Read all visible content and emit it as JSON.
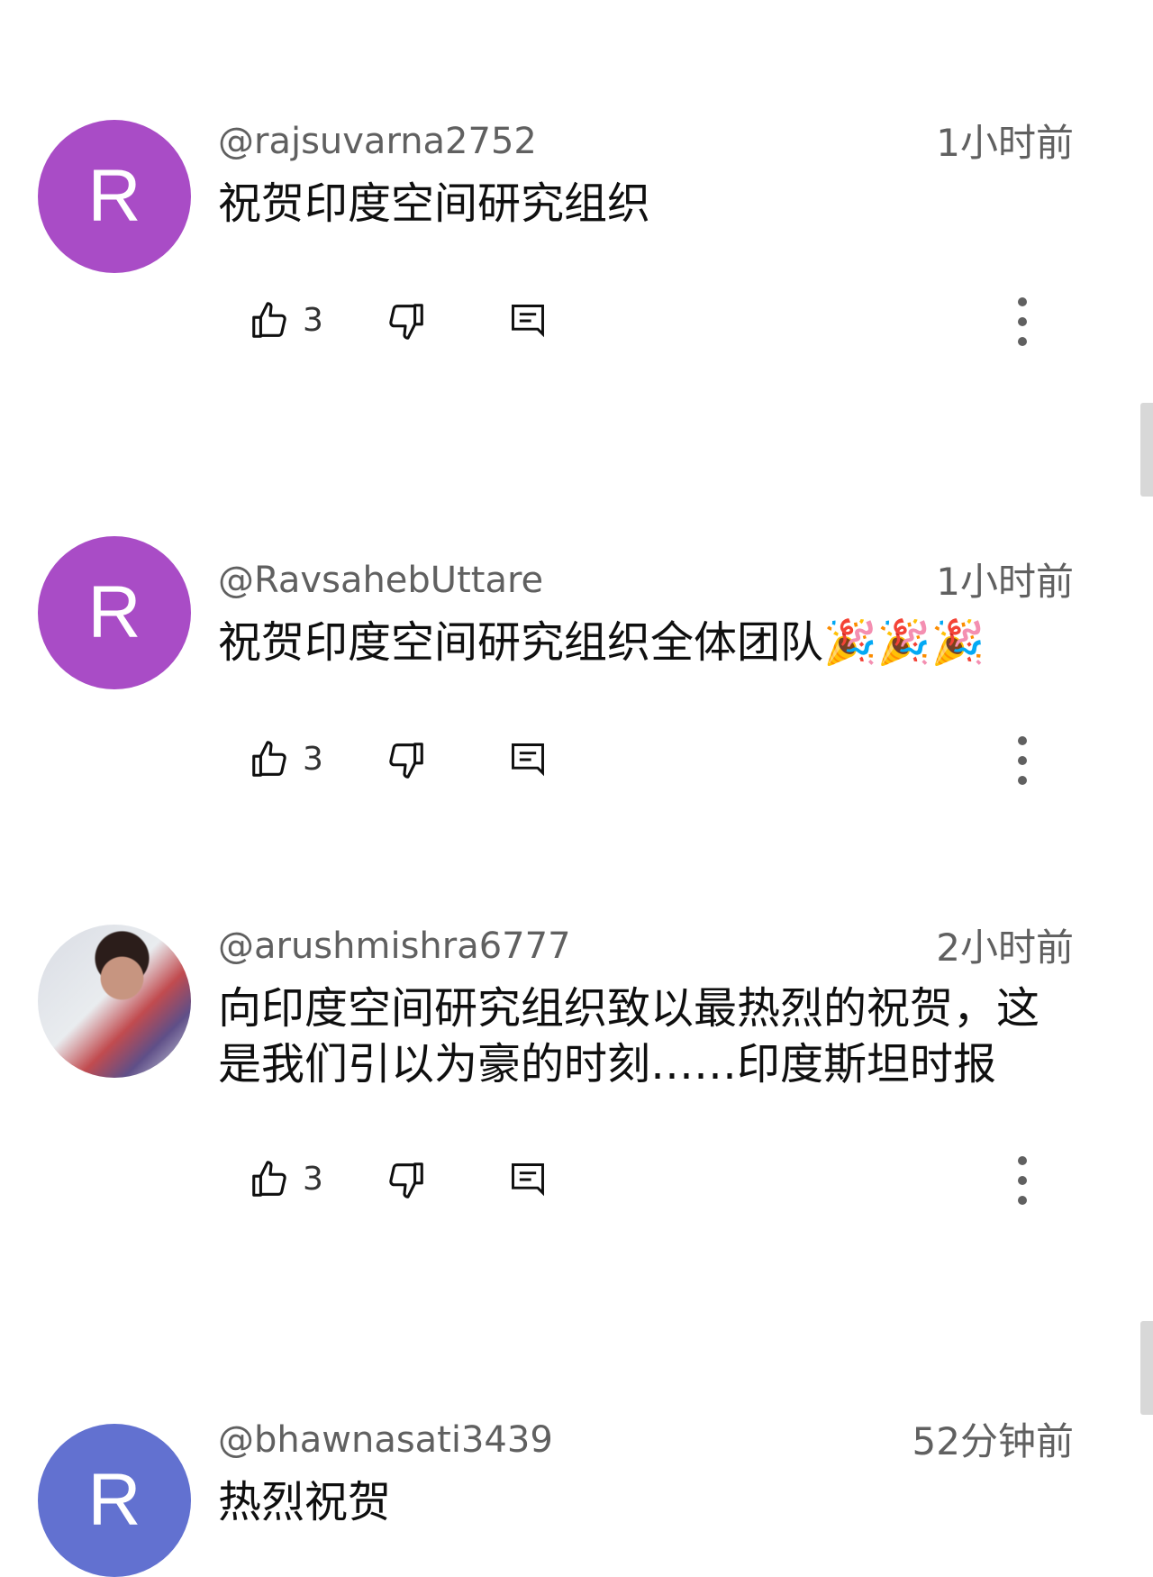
{
  "comments": [
    {
      "avatar_letter": "R",
      "avatar_color": "#a94cc6",
      "handle": "@rajsuvarna2752",
      "time": "1小时前",
      "text": "祝贺印度空间研究组织",
      "likes": "3"
    },
    {
      "avatar_letter": "R",
      "avatar_color": "#a94cc6",
      "handle": "@RavsahebUttare",
      "time": "1小时前",
      "text": "祝贺印度空间研究组织全体团队🎉🎉🎉",
      "likes": "3"
    },
    {
      "avatar_letter": "",
      "avatar_color": "#d9dce4",
      "handle": "@arushmishra6777",
      "time": "2小时前",
      "text": "向印度空间研究组织致以最热烈的祝贺，这是我们引以为豪的时刻……印度斯坦时报",
      "likes": "3"
    },
    {
      "avatar_letter": "R",
      "avatar_color": "#6271d0",
      "handle": "@bhawnasati3439",
      "time": "52分钟前",
      "text": "热烈祝贺",
      "likes": ""
    }
  ],
  "icons": {
    "like": "thumb-up-icon",
    "dislike": "thumb-down-icon",
    "reply": "reply-icon",
    "more": "more-vert-icon"
  }
}
